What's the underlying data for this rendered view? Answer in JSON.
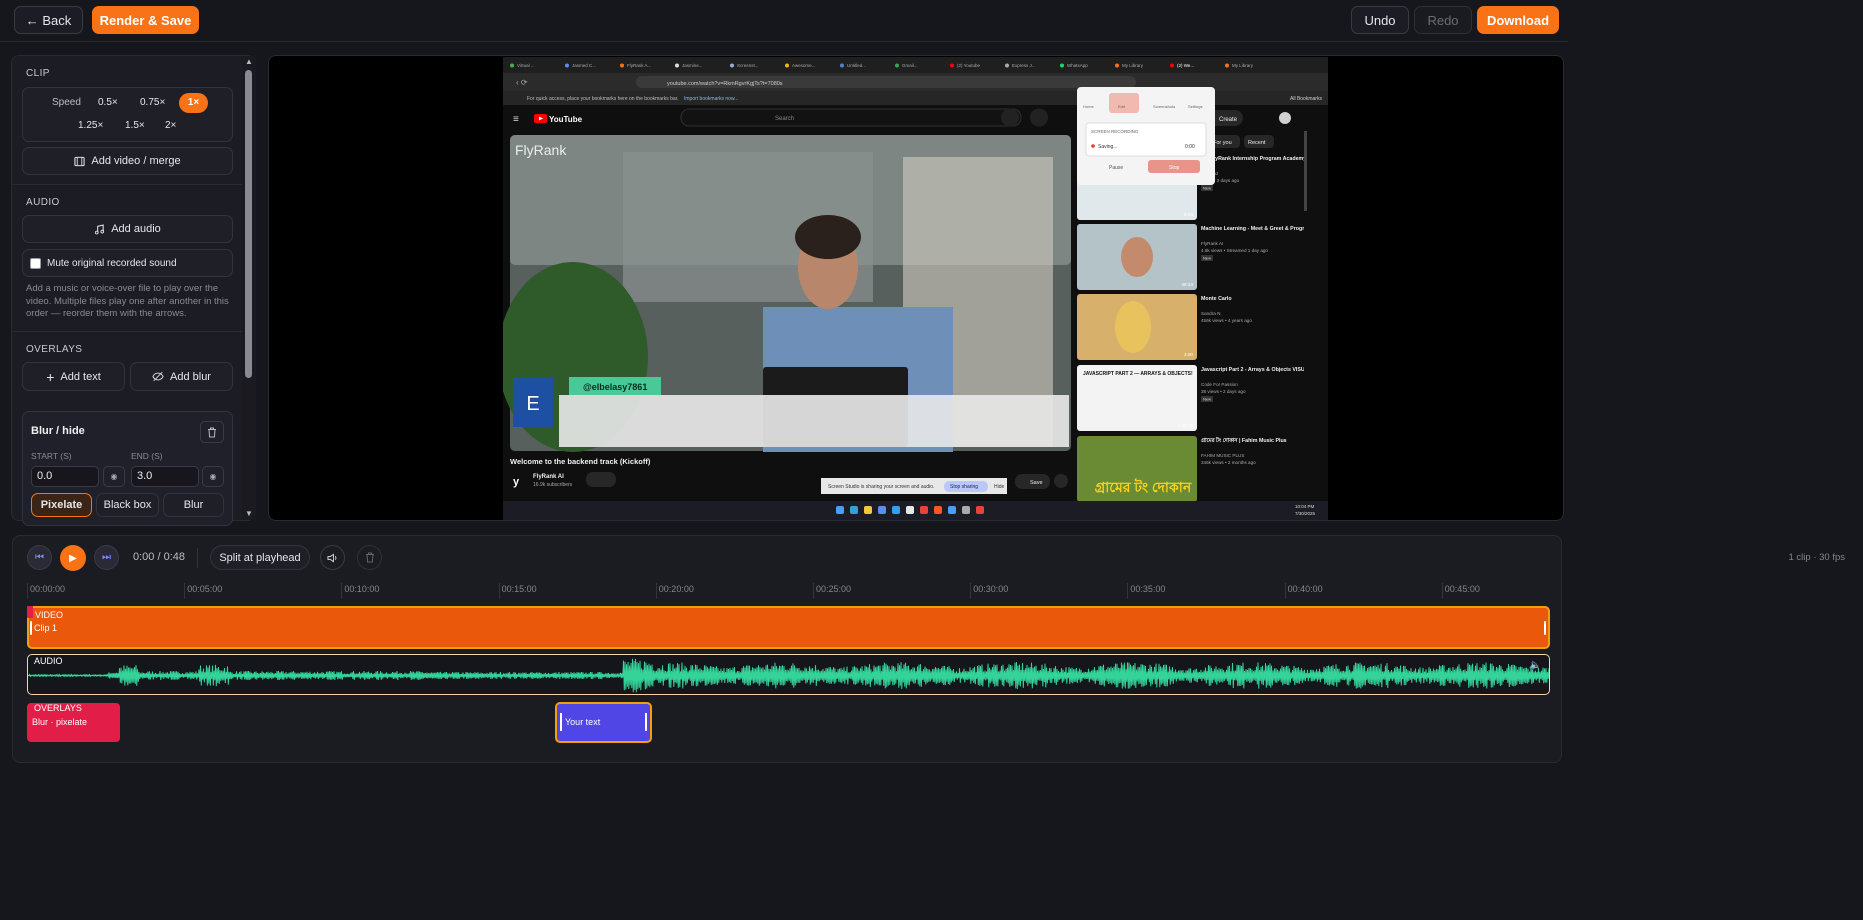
{
  "topbar": {
    "back_label": "← Back",
    "render_label": "Render & Save",
    "undo_label": "Undo",
    "redo_label": "Redo",
    "download_label": "Download"
  },
  "panel": {
    "clip_header": "CLIP",
    "speed_label": "Speed",
    "speeds": [
      "0.5×",
      "0.75×",
      "1×",
      "1.25×",
      "1.5×",
      "2×"
    ],
    "speed_selected": "1×",
    "add_video_label": "Add video / merge",
    "audio_header": "AUDIO",
    "add_audio_label": "Add audio",
    "mute_label": "Mute original recorded sound",
    "mute_checked": false,
    "audio_help": "Add a music or voice-over file to play over the video. Multiple files play one after another in this order — reorder them with the arrows.",
    "overlays_header": "OVERLAYS",
    "add_text_label": "Add text",
    "add_blur_label": "Add blur",
    "blur_card": {
      "title": "Blur / hide",
      "start_label": "START (S)",
      "end_label": "END (S)",
      "start_value": "0.0",
      "end_value": "3.0",
      "modes": [
        "Pixelate",
        "Black box",
        "Blur"
      ],
      "mode_selected": "Pixelate"
    }
  },
  "preview": {
    "tabs": [
      "Virtual ...",
      "Jasmed C...",
      "FlyRank A...",
      "Jasmine...",
      "Screenst...",
      "Awesome...",
      "Untitled...",
      "Gmail...",
      "(2) Youtube",
      "Express J...",
      "WhatsApp",
      "My Library",
      "(2) We...",
      "My Library"
    ],
    "url": "youtube.com/watch?v=RkmRgvrKgjTs?t=7080s",
    "bookmarks_hint": "For quick access, place your bookmarks here on the bookmarks bar.",
    "bookmarks_link": "Import bookmarks now...",
    "all_bookmarks": "All Bookmarks",
    "yt_logo": "YouTube",
    "yt_search": "Search",
    "yt_create": "Create",
    "video_watermark": "FlyRank",
    "video_title": "Welcome to the backend track (Kickoff)",
    "channel": "FlyRank AI",
    "subs": "16.9k subscribers",
    "handle": "@elbelasy7861",
    "handle_initial": "E",
    "rec_popup": {
      "title": "SCREEN RECORDING",
      "status": "Saving...",
      "time": "0:00",
      "pause": "Pause",
      "stop": "Stop",
      "tabs": [
        "Home",
        "Edit",
        "Screenshots",
        "Settings"
      ]
    },
    "chips": [
      "For you",
      "Recent"
    ],
    "share_notice": "Screen Studio is sharing your screen and audio.",
    "stop_sharing": "Stop sharing",
    "hide": "Hide",
    "save": "Save",
    "sidebar_videos": [
      {
        "title": "the FlyRank Internship Program Academy Works ...",
        "meta": "Mahinoz",
        "sub": "views • 3 days ago",
        "badge": "New",
        "dur": "6:24"
      },
      {
        "title": "Machine Learning - Meet & Greet & Program Overview w/...",
        "meta": "FlyRank AI",
        "sub": "4.8k views • Streamed 1 day ago",
        "badge": "New",
        "dur": "49:33"
      },
      {
        "title": "Monte Carlo",
        "meta": "Sandra N.",
        "sub": "456k views • 4 years ago",
        "badge": "",
        "dur": "3:00"
      },
      {
        "title": "Javascript Part 2 - Arrays & Objects VISUALIZED! (Map, ...",
        "meta": "Code For Passion",
        "sub": "38 views • 2 days ago",
        "badge": "New",
        "dur": "1:24:10"
      },
      {
        "title": "গ্রামের টং দোকান | Fahim Music Plus",
        "meta": "FAHIM MUSIC PLUS",
        "sub": "346k views • 2 months ago",
        "badge": "",
        "dur": ""
      }
    ],
    "thumb_text": "JAVASCRIPT PART 2 — ARRAYS & OBJECTS!",
    "bengali_thumb": "গ্রামের টং দোকান",
    "taskbar_time": "10:04 PM",
    "taskbar_date": "7/30/2025"
  },
  "timeline": {
    "time_display": "0:00 / 0:48",
    "split_label": "Split at playhead",
    "clip_info": "1 clip · 30 fps",
    "ticks": [
      "00:00:00",
      "00:05:00",
      "00:10:00",
      "00:15:00",
      "00:20:00",
      "00:25:00",
      "00:30:00",
      "00:35:00",
      "00:40:00",
      "00:45:00"
    ],
    "video_track_label": "VIDEO",
    "clip_name": "Clip 1",
    "audio_track_label": "AUDIO",
    "overlays_track_label": "OVERLAYS",
    "blur_overlay_label": "Blur · pixelate",
    "text_overlay_label": "Your text"
  },
  "colors": {
    "accent": "#f97316",
    "clip": "#ea580c",
    "waveform": "#34d399",
    "blur_overlay": "#e11d48",
    "text_overlay": "#4f46e5"
  }
}
